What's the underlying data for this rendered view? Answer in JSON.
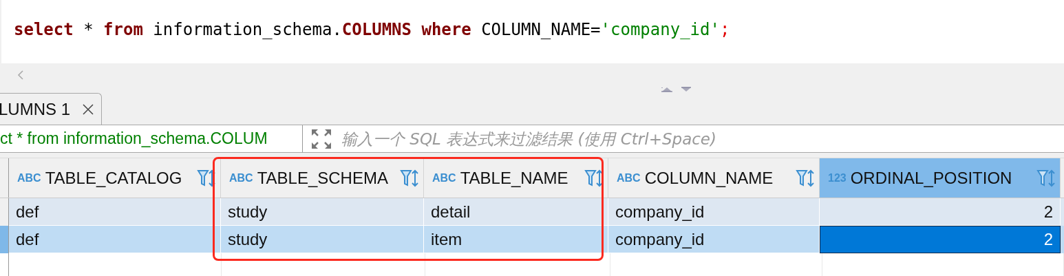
{
  "editor": {
    "tokens": [
      {
        "kind": "keyword",
        "text": "select"
      },
      {
        "kind": "plain",
        "text": " * "
      },
      {
        "kind": "keyword",
        "text": "from"
      },
      {
        "kind": "plain",
        "text": " information_schema."
      },
      {
        "kind": "keyword",
        "text": "COLUMNS"
      },
      {
        "kind": "keyword",
        "text": " where"
      },
      {
        "kind": "plain",
        "text": " COLUMN_NAME="
      },
      {
        "kind": "string",
        "text": "'company_id'"
      },
      {
        "kind": "punct",
        "text": ";"
      }
    ]
  },
  "results_tab": {
    "label": "LUMNS 1"
  },
  "filter": {
    "query": "ct * from information_schema.COLUM",
    "placeholder": "输入一个 SQL 表达式来过滤结果 (使用 Ctrl+Space)"
  },
  "table": {
    "columns": [
      {
        "type_label": "ABC",
        "name": "TABLE_CATALOG",
        "kind": "text",
        "selected": false
      },
      {
        "type_label": "ABC",
        "name": "TABLE_SCHEMA",
        "kind": "text",
        "selected": false
      },
      {
        "type_label": "ABC",
        "name": "TABLE_NAME",
        "kind": "text",
        "selected": false
      },
      {
        "type_label": "ABC",
        "name": "COLUMN_NAME",
        "kind": "text",
        "selected": false
      },
      {
        "type_label": "123",
        "name": "ORDINAL_POSITION",
        "kind": "number",
        "selected": true
      }
    ],
    "rows": [
      {
        "selected": false,
        "cells": [
          {
            "text": "def",
            "selected": false
          },
          {
            "text": "study",
            "selected": false
          },
          {
            "text": "detail",
            "selected": false
          },
          {
            "text": "company_id",
            "selected": false
          },
          {
            "text": "2",
            "selected": false
          }
        ]
      },
      {
        "selected": true,
        "cells": [
          {
            "text": "def",
            "selected": false
          },
          {
            "text": "study",
            "selected": false
          },
          {
            "text": "item",
            "selected": false
          },
          {
            "text": "company_id",
            "selected": false
          },
          {
            "text": "2",
            "selected": true
          }
        ]
      }
    ]
  },
  "annotation": {
    "kind": "rectangle"
  }
}
